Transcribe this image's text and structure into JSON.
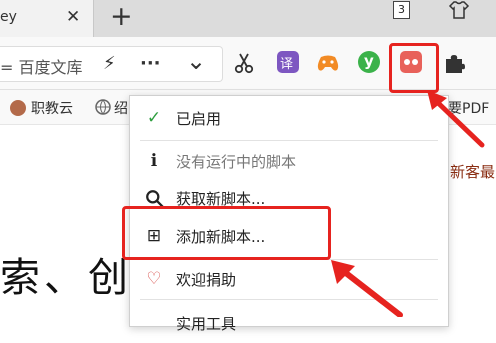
{
  "tab": {
    "title": "ey",
    "close": "✕",
    "new_tab": "+"
  },
  "top_right": {
    "counter": "3"
  },
  "address": {
    "text": "= 百度文库",
    "lightning": "⚡",
    "more": "···",
    "dropdown": "⌄"
  },
  "extensions": {
    "scissors_icon": "scissors-icon",
    "translate_label": "译",
    "game_icon": "gamepad-icon",
    "check_label": "y",
    "tampermonkey_icon": "tampermonkey-icon",
    "puzzle_icon": "puzzle-icon"
  },
  "bookmarks": [
    {
      "label": "职教云"
    },
    {
      "label": "绍"
    },
    {
      "label": "要PDF"
    }
  ],
  "page": {
    "big_text": "索、创作",
    "side_text": "新客最"
  },
  "menu": {
    "items": [
      {
        "label": "已启用",
        "icon": "✓"
      },
      {
        "label": "没有运行中的脚本",
        "icon": "ℹ"
      },
      {
        "label": "获取新脚本...",
        "icon": "🔍"
      },
      {
        "label": "添加新脚本...",
        "icon": "⊞"
      },
      {
        "label": "欢迎捐助",
        "icon": "♡"
      },
      {
        "label": "实用工具",
        "icon": ""
      }
    ]
  },
  "colors": {
    "highlight": "#e6231f",
    "check": "#2e9e3f",
    "tampermonkey": "#e8615a"
  }
}
